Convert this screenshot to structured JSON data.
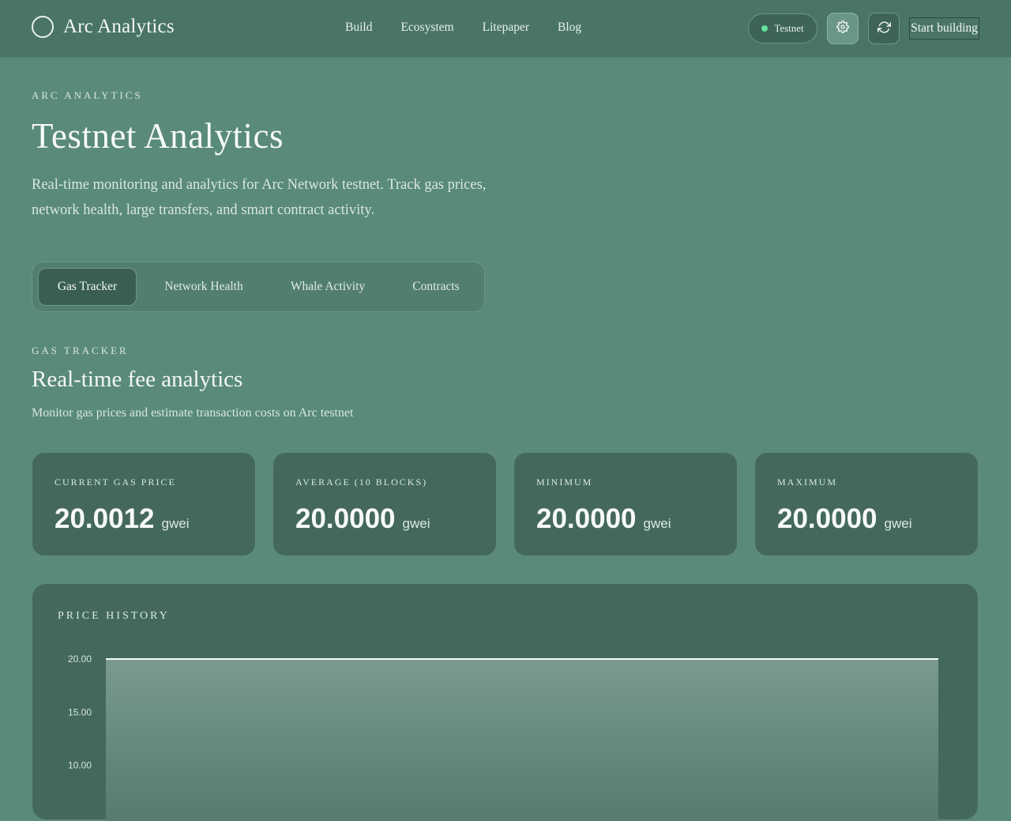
{
  "header": {
    "brand": "Arc Analytics",
    "nav": [
      "Build",
      "Ecosystem",
      "Litepaper",
      "Blog"
    ],
    "network_badge": "Testnet",
    "network_status_color": "#62e39a",
    "settings_icon": "gear-icon",
    "refresh_icon": "refresh-icon",
    "cta": "Start building"
  },
  "hero": {
    "eyebrow": "ARC ANALYTICS",
    "title": "Testnet Analytics",
    "description": "Real-time monitoring and analytics for Arc Network testnet. Track gas prices, network health, large transfers, and smart contract activity."
  },
  "tabs": [
    {
      "label": "Gas Tracker",
      "active": true
    },
    {
      "label": "Network Health",
      "active": false
    },
    {
      "label": "Whale Activity",
      "active": false
    },
    {
      "label": "Contracts",
      "active": false
    }
  ],
  "section": {
    "eyebrow": "GAS TRACKER",
    "title": "Real-time fee analytics",
    "description": "Monitor gas prices and estimate transaction costs on Arc testnet"
  },
  "stats": [
    {
      "label": "CURRENT GAS PRICE",
      "value": "20.0012",
      "unit": "gwei"
    },
    {
      "label": "AVERAGE (10 BLOCKS)",
      "value": "20.0000",
      "unit": "gwei"
    },
    {
      "label": "MINIMUM",
      "value": "20.0000",
      "unit": "gwei"
    },
    {
      "label": "MAXIMUM",
      "value": "20.0000",
      "unit": "gwei"
    }
  ],
  "chart_panel": {
    "title": "PRICE HISTORY"
  },
  "chart_data": {
    "type": "area",
    "title": "PRICE HISTORY",
    "xlabel": "",
    "ylabel": "",
    "y_ticks": [
      "20.00",
      "15.00",
      "10.00"
    ],
    "ylim": [
      0,
      20
    ],
    "series": [
      {
        "values": [
          20.0,
          20.0,
          20.0,
          20.0,
          20.0,
          20.0,
          20.0,
          20.0,
          20.0,
          20.0
        ]
      }
    ],
    "line_color": "#f4f8f6",
    "grid": false
  }
}
